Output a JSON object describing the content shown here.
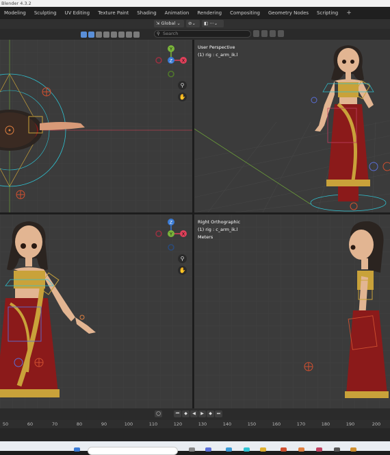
{
  "window": {
    "title": "Blender 4.3.2"
  },
  "workspace_tabs": [
    "Modeling",
    "Sculpting",
    "UV Editing",
    "Texture Paint",
    "Shading",
    "Animation",
    "Rendering",
    "Compositing",
    "Geometry Nodes",
    "Scripting",
    "+"
  ],
  "header": {
    "orientation_label": "Global",
    "search_placeholder": "Search"
  },
  "viewports": {
    "top_right": {
      "line1": "User Perspective",
      "line2": "(1) rig : c_arm_ik.l"
    },
    "bottom_right": {
      "line1": "Right Orthographic",
      "line2": "(1) rig : c_arm_ik.l",
      "line3": "Meters"
    }
  },
  "gizmo": {
    "x": "X",
    "y": "Y",
    "z": "Z"
  },
  "timeline": {
    "frame_numbers": [
      "50",
      "60",
      "70",
      "80",
      "90",
      "100",
      "110",
      "120",
      "130",
      "140",
      "150",
      "160",
      "170",
      "180",
      "190",
      "200"
    ]
  },
  "colors": {
    "viewport_bg": "#3b3b3b",
    "dress_red": "#8b1a1a",
    "gold": "#c9a23a",
    "axis_x": "#e0405a",
    "axis_y": "#7ab43a",
    "axis_z": "#3a7bd5",
    "rig_cyan": "#2fc4d4"
  }
}
